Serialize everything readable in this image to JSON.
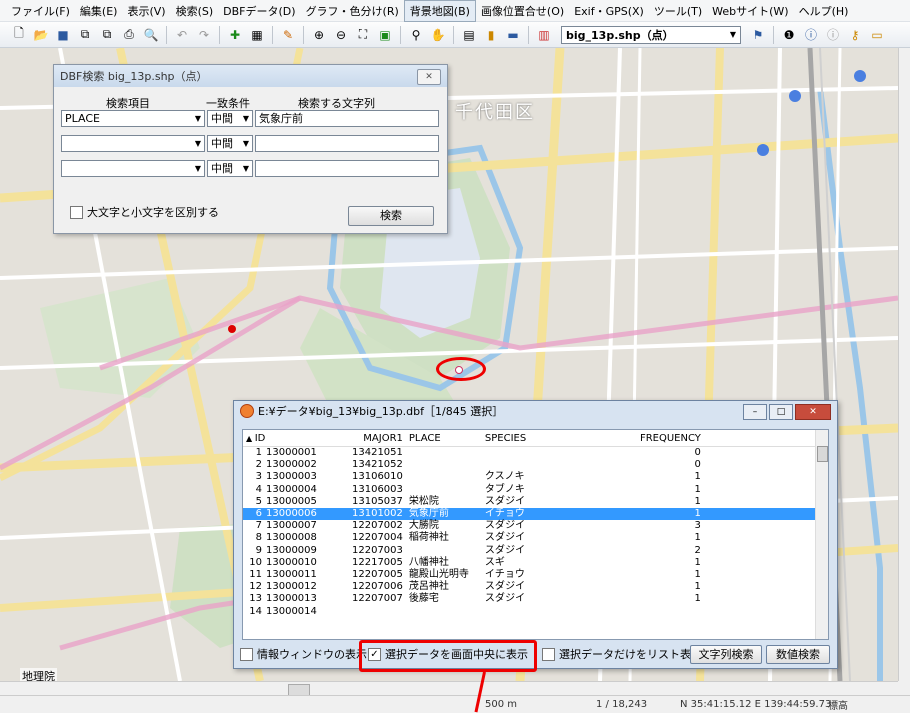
{
  "menubar": {
    "items": [
      "ファイル(F)",
      "編集(E)",
      "表示(V)",
      "検索(S)",
      "DBFデータ(D)",
      "グラフ・色分け(R)",
      "背景地図(B)",
      "画像位置合せ(O)",
      "Exif・GPS(X)",
      "ツール(T)",
      "Webサイト(W)",
      "ヘルプ(H)"
    ],
    "active_index": 6
  },
  "toolbar": {
    "layer_combo": "big_13p.shp（点）",
    "icons": [
      "new-icon",
      "open-icon",
      "save-icon",
      "copy-icon",
      "paste-icon",
      "print-icon",
      "preview-icon",
      "undo-icon",
      "redo-icon",
      "add-layer-icon",
      "layer-manager-icon",
      "edit-icon",
      "zoom-in-icon",
      "zoom-out-icon",
      "zoom-extent-icon",
      "zoom-layer-icon",
      "find-icon",
      "pan-icon",
      "table-icon",
      "chart-icon",
      "legend-icon",
      "classify-icon",
      "layer-settings-icon",
      "info-icon",
      "info2-icon",
      "info3-icon",
      "probe-icon",
      "ruler-icon"
    ]
  },
  "map": {
    "place_label": "千代田区",
    "attribution": "地理院"
  },
  "dbf_search": {
    "title": "DBF検索  big_13p.shp（点）",
    "close": "✕",
    "col_field": "検索項目",
    "col_match": "一致条件",
    "col_text": "検索する文字列",
    "rows": [
      {
        "field": "PLACE",
        "match": "中間",
        "text": "気象庁前"
      },
      {
        "field": "",
        "match": "中間",
        "text": ""
      },
      {
        "field": "",
        "match": "中間",
        "text": ""
      }
    ],
    "case_label": "大文字と小文字を区別する",
    "search_button": "検索"
  },
  "table_window": {
    "title": "E:¥データ¥big_13¥big_13p.dbf［1/845 選択］",
    "columns": [
      "ID",
      "MAJOR1",
      "PLACE",
      "SPECIES",
      "FREQUENCY"
    ],
    "rows": [
      [
        "1",
        "13000001",
        "13421051",
        "",
        "",
        "0"
      ],
      [
        "2",
        "13000002",
        "13421052",
        "",
        "",
        "0"
      ],
      [
        "3",
        "13000003",
        "13106010",
        "",
        "クスノキ",
        "1"
      ],
      [
        "4",
        "13000004",
        "13106003",
        "",
        "タブノキ",
        "1"
      ],
      [
        "5",
        "13000005",
        "13105037",
        "栄松院",
        "スダジイ",
        "1"
      ],
      [
        "6",
        "13000006",
        "13101002",
        "気象庁前",
        "イチョウ",
        "1"
      ],
      [
        "7",
        "13000007",
        "12207002",
        "大勝院",
        "スダジイ",
        "3"
      ],
      [
        "8",
        "13000008",
        "12207004",
        "稲荷神社",
        "スダジイ",
        "1"
      ],
      [
        "9",
        "13000009",
        "12207003",
        "",
        "スダジイ",
        "2"
      ],
      [
        "10",
        "13000010",
        "12217005",
        "八幡神社",
        "スギ",
        "1"
      ],
      [
        "11",
        "13000011",
        "12207005",
        "龍殿山光明寺",
        "イチョウ",
        "1"
      ],
      [
        "12",
        "13000012",
        "12207006",
        "茂呂神社",
        "スダジイ",
        "1"
      ],
      [
        "13",
        "13000013",
        "12207007",
        "後藤宅",
        "スダジイ",
        "1"
      ],
      [
        "14",
        "13000014",
        "",
        "",
        "",
        ""
      ]
    ],
    "selected_row": 5,
    "opt_info": "情報ウィンドウの表示",
    "opt_center": "選択データを画面中央に表示",
    "opt_center_checked": true,
    "opt_listonly": "選択データだけをリスト表示",
    "btn_text_search": "文字列検索",
    "btn_num_search": "数値検索"
  },
  "status": {
    "scale": "500 m",
    "ratio": "1 / 18,243",
    "coords": "N 35:41:15.12  E 139:44:59.73",
    "elev": "標高"
  },
  "colors": {
    "highlight": "#e00000",
    "selection": "#3399ff"
  }
}
